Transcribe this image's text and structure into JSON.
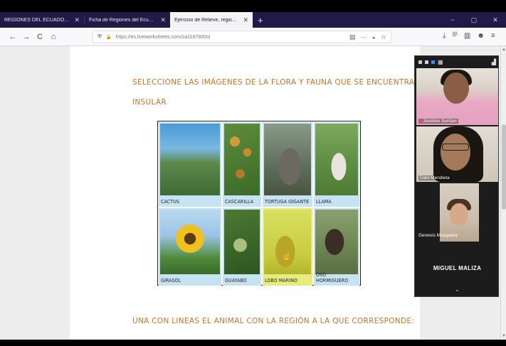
{
  "tabs": [
    {
      "label": "REGIONES DEL ECUADOR fichas",
      "active": false
    },
    {
      "label": "Ficha de Regiones del Ecuador",
      "active": false
    },
    {
      "label": "Ejercicio de Relieve, regiones natu",
      "active": true
    }
  ],
  "window_controls": {
    "minimize": "−",
    "restore": "▢",
    "close": "✕"
  },
  "nav": {
    "back": "←",
    "forward": "→",
    "reload": "C",
    "home": "⌂"
  },
  "url": "https://es.liveworksheets.com/sa1187800sl",
  "url_icons": {
    "shield": "⛨",
    "lock": "🔒",
    "reader": "▤",
    "more": "···",
    "pocket": "◒",
    "bookmark": "☆"
  },
  "toolbar_icons": {
    "download": "⤓",
    "library": "|||\\",
    "sidebar": "▥",
    "account": "☻",
    "menu": "≡"
  },
  "worksheet": {
    "instruction_1_line1": "SELECCIONE LAS IMÁGENES DE LA FLORA Y FAUNA QUE SE ENCUENTRA EN LA REGION",
    "instruction_1_line2": "INSULAR",
    "instruction_2": "UNA CON LINEAS EL ANIMAL CON LA REGIÓN A LA QUE CORRESPONDE:",
    "items": [
      {
        "caption": "CACTUS",
        "photo": "cactus-photo"
      },
      {
        "caption": "CASCARILLA",
        "photo": "cascarilla-photo"
      },
      {
        "caption": "TORTUGA GIGANTE",
        "photo": "giant-tortoise-photo"
      },
      {
        "caption": "LLAMA",
        "photo": "llama-photo"
      },
      {
        "caption": "GIRASOL",
        "photo": "sunflower-photo"
      },
      {
        "caption": "GUAYABO",
        "photo": "guava-photo"
      },
      {
        "caption": "LOBO MARINO",
        "photo": "sea-lion-photo",
        "selected": true
      },
      {
        "caption": "OSO HORMIGUERO",
        "photo": "anteater-photo"
      }
    ]
  },
  "video_call": {
    "participants": [
      {
        "name": "Joseline Suntaxi"
      },
      {
        "name": "Dani Mendieta"
      },
      {
        "name": "Genesis Mosquera"
      }
    ],
    "speaker_name": "MIGUEL MALIZA",
    "chevron": "⌄"
  }
}
